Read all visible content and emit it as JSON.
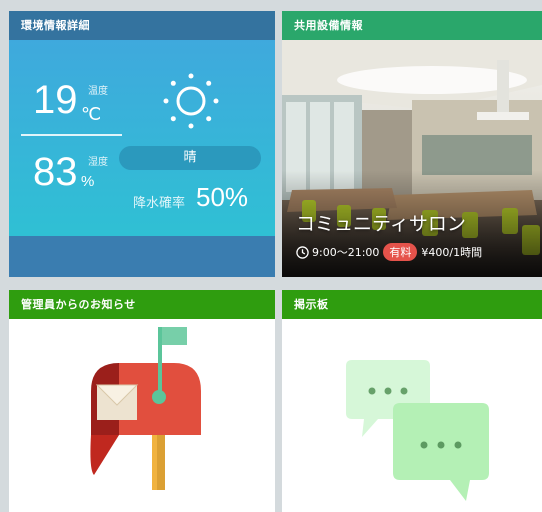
{
  "weather": {
    "title": "環境情報詳細",
    "temperature": "19",
    "temperature_unit": "℃",
    "temperature_label": "温度",
    "humidity": "83",
    "humidity_unit": "%",
    "humidity_label": "湿度",
    "condition": "晴",
    "condition_icon": "sun-icon",
    "rain_label": "降水確率",
    "rain_value": "50%"
  },
  "facility": {
    "title": "共用設備情報",
    "name": "コミュニティサロン",
    "hours": "9:00〜21:00",
    "paid_badge": "有料",
    "price": "¥400/1時間",
    "clock_icon": "clock-icon"
  },
  "notice": {
    "title": "管理員からのお知らせ",
    "icon": "mailbox-icon"
  },
  "board": {
    "title": "掲示板",
    "icon": "chat-bubbles-icon"
  },
  "colors": {
    "weather_header": "#34739f",
    "facility_header": "#2aa76b",
    "green_header": "#2f9d0f",
    "badge_red": "#e5534b"
  }
}
